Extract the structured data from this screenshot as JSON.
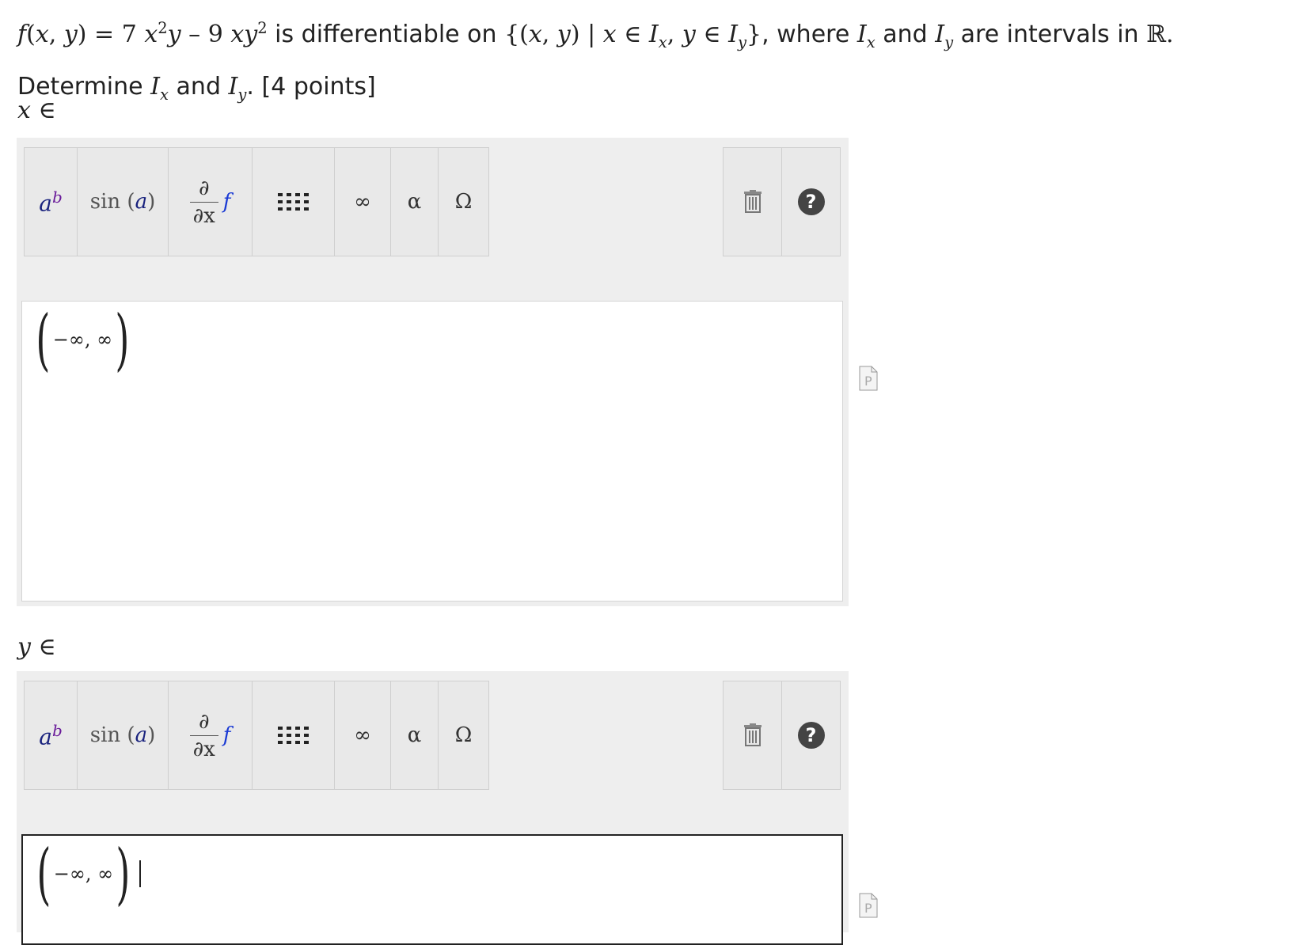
{
  "question": {
    "line1_func": "f(x, y) = 7 x",
    "line1_text1": " is differentiable on ",
    "set_text": "{(x, y) | x ∈ I",
    "where_text": ", where ",
    "and_text": " and ",
    "intervals_text": " are intervals in ",
    "R": "ℝ",
    "line2_prefix": "Determine ",
    "line2_and": " and ",
    "points": ". [4 points]"
  },
  "x_label": "x ∈",
  "y_label": "y ∈",
  "toolbar": {
    "a": "a",
    "b": "b",
    "sin": "sin",
    "sin_arg": "a",
    "partial_top": "∂",
    "partial_bottom": "∂x",
    "f": "f",
    "infinity": "∞",
    "alpha": "α",
    "omega": "Ω",
    "help": "?"
  },
  "x_answer": "−∞, ∞",
  "y_answer": "−∞, ∞"
}
